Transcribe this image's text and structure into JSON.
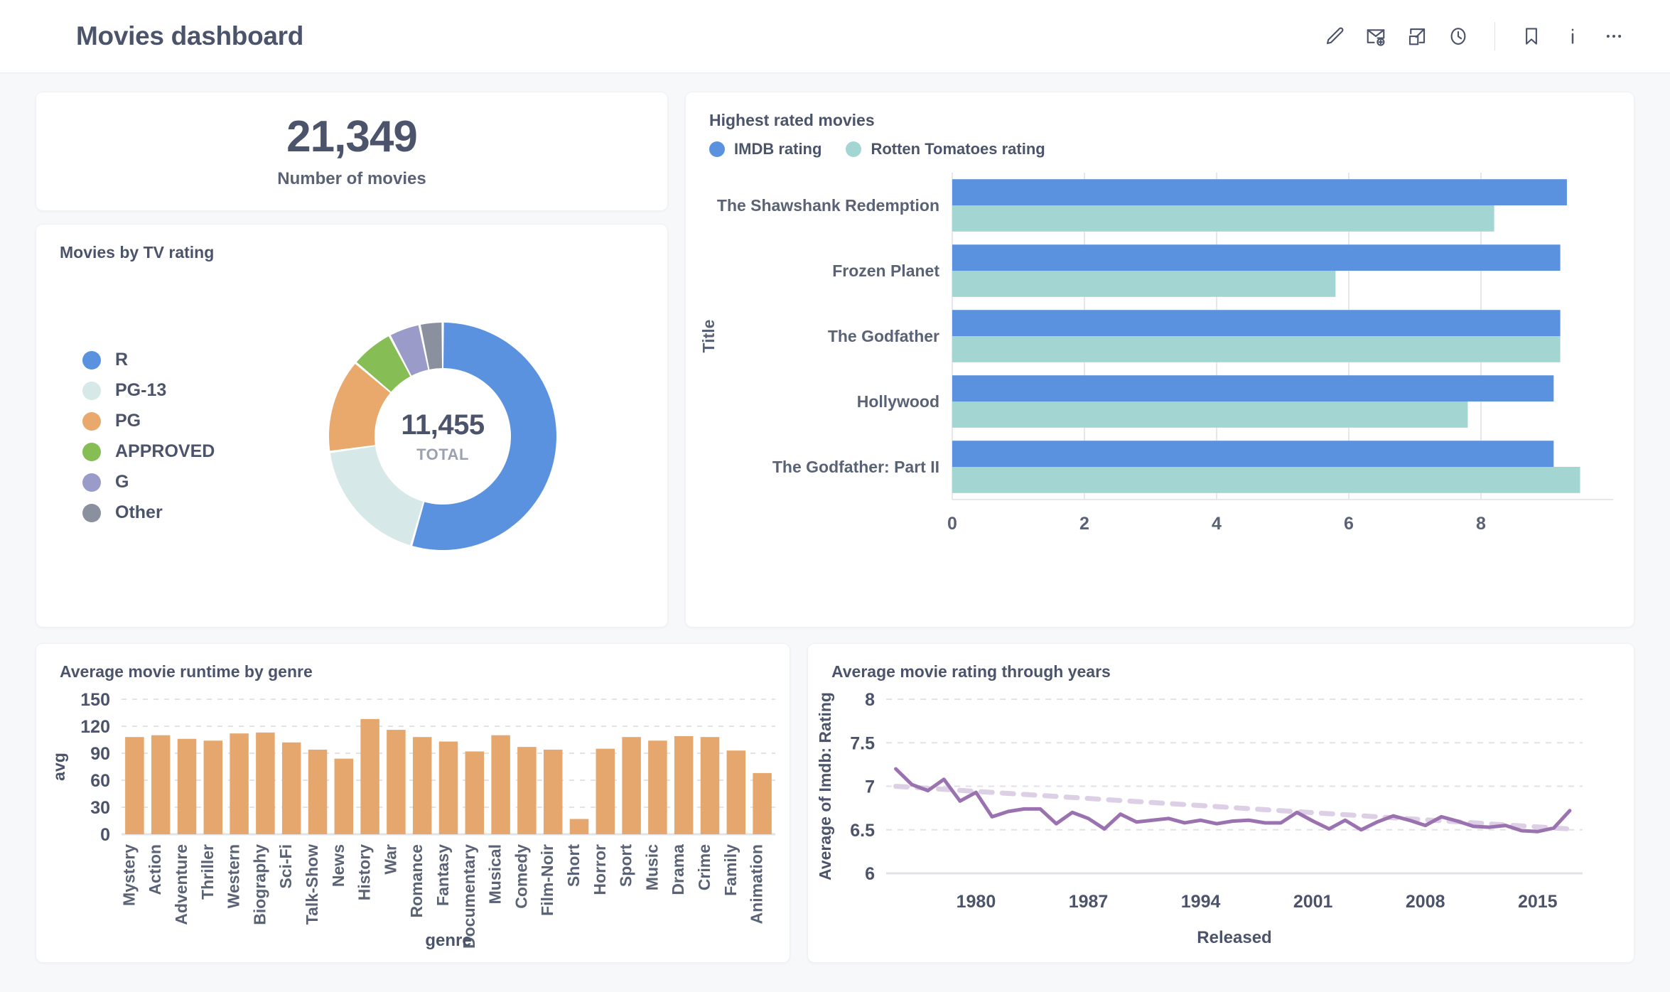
{
  "header": {
    "title": "Movies dashboard",
    "actions": [
      {
        "name": "edit-dashboard-button",
        "icon": "pencil-icon"
      },
      {
        "name": "subscription-button",
        "icon": "envelope-plus-icon"
      },
      {
        "name": "share-button",
        "icon": "share-export-icon"
      },
      {
        "name": "history-button",
        "icon": "clock-icon"
      },
      {
        "name": "bookmark-button",
        "icon": "bookmark-icon"
      },
      {
        "name": "info-button",
        "icon": "info-icon"
      },
      {
        "name": "more-options-button",
        "icon": "ellipsis-icon"
      }
    ]
  },
  "scalar_card": {
    "value": "21,349",
    "label": "Number of movies"
  },
  "donut_card": {
    "title": "Movies by TV rating"
  },
  "hbar_card": {
    "title": "Highest rated movies",
    "legend": [
      {
        "label": "IMDB rating",
        "color": "#5b92e0"
      },
      {
        "label": "Rotten Tomatoes rating",
        "color": "#a3d6d2"
      }
    ]
  },
  "vbar_card": {
    "title": "Average movie runtime by genre"
  },
  "line_card": {
    "title": "Average movie rating through years"
  },
  "colors": {
    "blue": "#5b92e0",
    "light_teal": "#d6e8e7",
    "orange": "#e9a86c",
    "green": "#87bd55",
    "purple": "#9a9bc8",
    "gray": "#8b909f",
    "rt_teal": "#a3d6d2",
    "bar_orange": "#e6a76e",
    "line_purple": "#9b72b0",
    "trend_purple": "#ddd0e6",
    "text": "#4c546b",
    "grid": "#e6e7ea"
  },
  "chart_data": [
    {
      "type": "pie",
      "title": "Movies by TV rating",
      "center_value": "11,455",
      "center_label": "TOTAL",
      "legend_position": "left",
      "categories": [
        "R",
        "PG-13",
        "PG",
        "APPROVED",
        "G",
        "Other"
      ],
      "values": [
        6240,
        2100,
        1530,
        700,
        510,
        375
      ],
      "percents": [
        54.5,
        18.3,
        13.4,
        6.1,
        4.5,
        3.3
      ],
      "colors": [
        "#5b92e0",
        "#d6e8e7",
        "#e9a86c",
        "#87bd55",
        "#9a9bc8",
        "#8b909f"
      ]
    },
    {
      "type": "bar",
      "orientation": "horizontal",
      "title": "Highest rated movies",
      "xlabel": "",
      "ylabel": "Title",
      "xlim": [
        0,
        10
      ],
      "xticks": [
        0,
        2,
        4,
        6,
        8
      ],
      "grid": true,
      "categories": [
        "The Shawshank Redemption",
        "Frozen Planet",
        "The Godfather",
        "Hollywood",
        "The Godfather: Part II"
      ],
      "series": [
        {
          "name": "IMDB rating",
          "color": "#5b92e0",
          "values": [
            9.3,
            9.2,
            9.2,
            9.1,
            9.1
          ]
        },
        {
          "name": "Rotten Tomatoes rating",
          "color": "#a3d6d2",
          "values": [
            8.2,
            5.8,
            9.2,
            7.8,
            9.5
          ]
        }
      ]
    },
    {
      "type": "bar",
      "orientation": "vertical",
      "title": "Average movie runtime by genre",
      "xlabel": "genre",
      "ylabel": "avg",
      "ylim": [
        0,
        150
      ],
      "yticks": [
        0,
        30,
        60,
        90,
        120,
        150
      ],
      "grid": true,
      "color": "#e6a76e",
      "categories": [
        "Mystery",
        "Action",
        "Adventure",
        "Thriller",
        "Western",
        "Biography",
        "Sci-Fi",
        "Talk-Show",
        "News",
        "History",
        "War",
        "Romance",
        "Fantasy",
        "Documentary",
        "Musical",
        "Comedy",
        "Film-Noir",
        "Short",
        "Horror",
        "Sport",
        "Music",
        "Drama",
        "Crime",
        "Family",
        "Animation"
      ],
      "values": [
        108,
        110,
        106,
        104,
        112,
        113,
        102,
        94,
        84,
        128,
        116,
        108,
        103,
        92,
        110,
        97,
        94,
        17,
        95,
        108,
        104,
        109,
        108,
        93,
        68
      ]
    },
    {
      "type": "line",
      "title": "Average movie rating through years",
      "xlabel": "Released",
      "ylabel": "Average of Imdb: Rating",
      "ylim": [
        6,
        8
      ],
      "yticks": [
        6,
        6.5,
        7,
        7.5,
        8
      ],
      "xticks": [
        1980,
        1987,
        1994,
        2001,
        2008,
        2015
      ],
      "grid": true,
      "series": [
        {
          "name": "Average of Imdb: Rating",
          "color": "#9b72b0",
          "x": [
            1975,
            1976,
            1977,
            1978,
            1979,
            1980,
            1981,
            1982,
            1983,
            1984,
            1985,
            1986,
            1987,
            1988,
            1989,
            1990,
            1991,
            1992,
            1993,
            1994,
            1995,
            1996,
            1997,
            1998,
            1999,
            2000,
            2001,
            2002,
            2003,
            2004,
            2005,
            2006,
            2007,
            2008,
            2009,
            2010,
            2011,
            2012,
            2013,
            2014,
            2015,
            2016,
            2017
          ],
          "values": [
            7.2,
            7.02,
            6.95,
            7.08,
            6.83,
            6.93,
            6.65,
            6.71,
            6.74,
            6.74,
            6.57,
            6.7,
            6.63,
            6.51,
            6.68,
            6.59,
            6.61,
            6.63,
            6.58,
            6.61,
            6.57,
            6.6,
            6.61,
            6.58,
            6.58,
            6.7,
            6.6,
            6.51,
            6.61,
            6.5,
            6.59,
            6.66,
            6.61,
            6.55,
            6.65,
            6.6,
            6.54,
            6.53,
            6.55,
            6.49,
            6.48,
            6.52,
            6.72,
            6.86
          ]
        },
        {
          "name": "trend",
          "color": "#ddd0e6",
          "style": "dashed",
          "x": [
            1975,
            2017
          ],
          "values": [
            7.0,
            6.51
          ]
        }
      ]
    }
  ]
}
